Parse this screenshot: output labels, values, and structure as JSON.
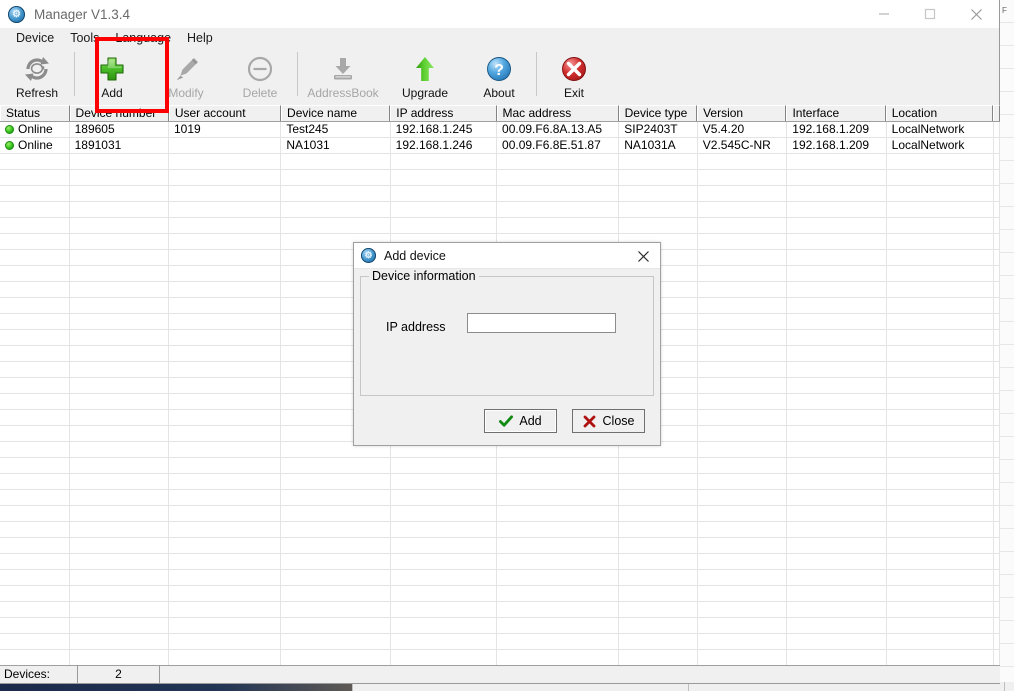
{
  "window": {
    "title": "Manager V1.3.4",
    "icon": "app-globe-icon",
    "controls": {
      "minimize": "minimize-icon",
      "maximize": "maximize-icon",
      "close": "close-icon"
    }
  },
  "menu": {
    "items": [
      {
        "label": "Device"
      },
      {
        "label": "Tools"
      },
      {
        "label": "Language"
      },
      {
        "label": "Help"
      }
    ]
  },
  "toolbar": {
    "buttons": [
      {
        "label": "Refresh",
        "icon": "refresh-icon",
        "disabled": false
      },
      {
        "label": "Add",
        "icon": "plus-icon",
        "disabled": false
      },
      {
        "label": "Modify",
        "icon": "pencil-icon",
        "disabled": true
      },
      {
        "label": "Delete",
        "icon": "minus-circle-icon",
        "disabled": true
      },
      {
        "label": "AddressBook",
        "icon": "download-icon",
        "disabled": true
      },
      {
        "label": "Upgrade",
        "icon": "up-arrow-icon",
        "disabled": false
      },
      {
        "label": "About",
        "icon": "question-icon",
        "disabled": false
      },
      {
        "label": "Exit",
        "icon": "red-x-icon",
        "disabled": false
      }
    ],
    "highlight": {
      "target": "Add",
      "color": "#ff0000"
    }
  },
  "table": {
    "columns": [
      {
        "label": "Status",
        "width": 70
      },
      {
        "label": "Device number",
        "width": 100
      },
      {
        "label": "User account",
        "width": 113
      },
      {
        "label": "Device name",
        "width": 110
      },
      {
        "label": "IP address",
        "width": 107
      },
      {
        "label": "Mac address",
        "width": 123
      },
      {
        "label": "Device type",
        "width": 79
      },
      {
        "label": "Version",
        "width": 90
      },
      {
        "label": "Interface",
        "width": 100
      },
      {
        "label": "Location",
        "width": 108
      }
    ],
    "rows": [
      {
        "status": "Online",
        "device_number": "189605",
        "user_account": "1019",
        "device_name": "Test245",
        "ip_address": "192.168.1.245",
        "mac_address": "00.09.F6.8A.13.A5",
        "device_type": "SIP2403T",
        "version": "V5.4.20",
        "interface": "192.168.1.209",
        "location": "LocalNetwork"
      },
      {
        "status": "Online",
        "device_number": "1891031",
        "user_account": "",
        "device_name": "NA1031",
        "ip_address": "192.168.1.246",
        "mac_address": "00.09.F6.8E.51.87",
        "device_type": "NA1031A",
        "version": "V2.545C-NR",
        "interface": "192.168.1.209",
        "location": "LocalNetwork"
      }
    ],
    "empty_row_count": 33
  },
  "status_bar": {
    "devices_label": "Devices:",
    "devices_count": "2",
    "extra": ""
  },
  "dialog": {
    "title": "Add device",
    "icon": "app-globe-icon",
    "close_icon": "close-icon",
    "group_legend": "Device information",
    "ip_address_label": "IP address",
    "ip_address_value": "",
    "ip_address_placeholder": "",
    "buttons": [
      {
        "label": "Add",
        "icon": "green-check-icon"
      },
      {
        "label": "Close",
        "icon": "red-x-icon"
      }
    ]
  },
  "colors": {
    "accent_red": "#ff0000",
    "status_online": "#2fbf17",
    "window_chrome": "#f0f0f0",
    "exit_red": "#cc2222",
    "upgrade_green": "#22aa22",
    "about_blue": "#3a8fc7"
  },
  "background": {
    "right_rows": [
      "F",
      "",
      "",
      "",
      "",
      "",
      "",
      "",
      "",
      "",
      "",
      "",
      "",
      "",
      "",
      "",
      "",
      "",
      "",
      "",
      "",
      "",
      "",
      "",
      "",
      "",
      "",
      "",
      "",
      ""
    ]
  }
}
